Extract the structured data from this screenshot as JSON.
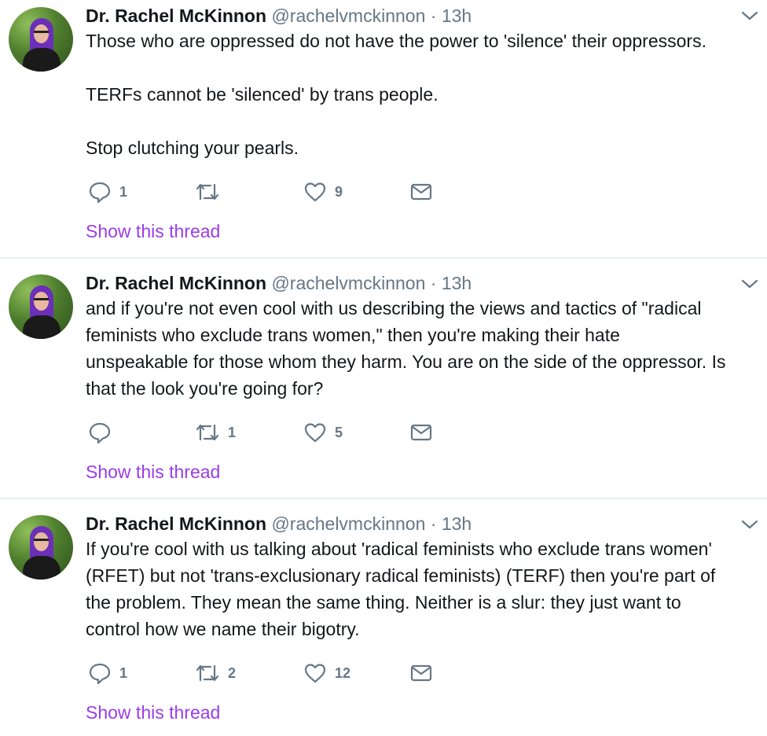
{
  "tweets": [
    {
      "name": "Dr. Rachel McKinnon",
      "handle": "@rachelvmckinnon",
      "separator": "·",
      "time": "13h",
      "paragraphs": [
        "Those who are oppressed do not have the power to 'silence' their oppressors.",
        "TERFs cannot be 'silenced' by trans people.",
        "Stop clutching your pearls."
      ],
      "reply_count": "1",
      "retweet_count": "",
      "like_count": "9",
      "show_thread": "Show this thread"
    },
    {
      "name": "Dr. Rachel McKinnon",
      "handle": "@rachelvmckinnon",
      "separator": "·",
      "time": "13h",
      "text_lines": [
        "and if you're not even cool with us describing the views and tactics of \"radical",
        "feminists who exclude trans women,\" then you're making their hate",
        "unspeakable for those whom they harm. You are on the side of the oppressor. Is",
        "that the look you're going for?"
      ],
      "reply_count": "",
      "retweet_count": "1",
      "like_count": "5",
      "show_thread": "Show this thread"
    },
    {
      "name": "Dr. Rachel McKinnon",
      "handle": "@rachelvmckinnon",
      "separator": "·",
      "time": "13h",
      "text_lines": [
        "If you're cool with us talking about 'radical feminists who exclude trans women'",
        "(RFET) but not 'trans-exclusionary radical feminists) (TERF) then you're part of",
        "the problem. They mean the same thing. Neither is a slur: they just want to",
        "control how we name their bigotry."
      ],
      "reply_count": "1",
      "retweet_count": "2",
      "like_count": "12",
      "show_thread": "Show this thread"
    }
  ],
  "colors": {
    "text": "#14171a",
    "muted": "#657786",
    "link": "#9b3ce8",
    "divider": "#e6ecf0"
  },
  "icons": [
    "reply-icon",
    "retweet-icon",
    "like-icon",
    "message-icon",
    "chevron-down-icon"
  ]
}
